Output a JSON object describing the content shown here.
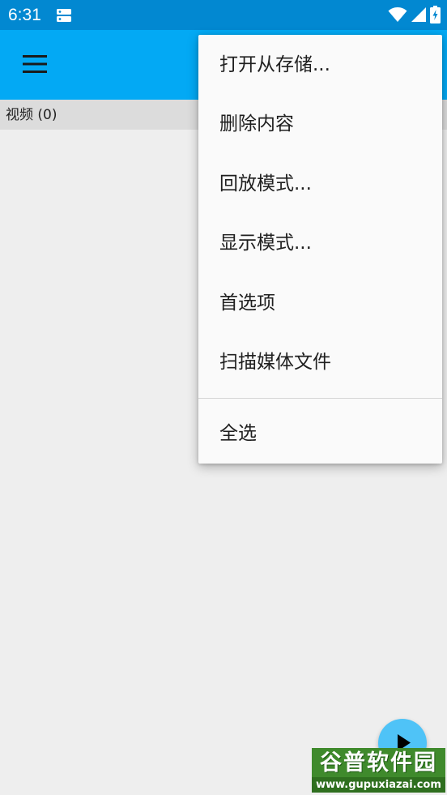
{
  "status_bar": {
    "time": "6:31",
    "icons": [
      "sim-card-icon",
      "wifi-icon",
      "signal-icon",
      "battery-charging-icon"
    ]
  },
  "app_bar": {
    "background": "#03a9f4",
    "nav_icon": "menu-icon"
  },
  "section": {
    "label": "视频 (0)"
  },
  "overflow_menu": {
    "items": [
      "打开从存储...",
      "删除内容",
      "回放模式...",
      "显示模式...",
      "首选项",
      "扫描媒体文件",
      "全选"
    ]
  },
  "fab": {
    "icon": "play-icon",
    "color": "#4fc3f7"
  },
  "watermark": {
    "brand": "谷普软件园",
    "url": "www.gupuxiazai.com"
  }
}
